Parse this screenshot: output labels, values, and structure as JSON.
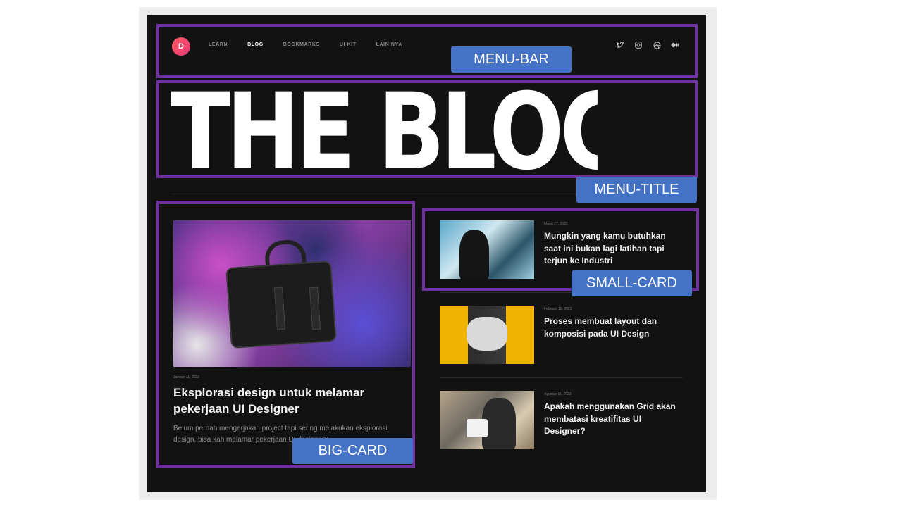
{
  "brand": {
    "avatar_letter": "D",
    "avatar_colors": [
      "#ff5a5f",
      "#e8357a"
    ]
  },
  "nav": {
    "items": [
      "LEARN",
      "BLOG",
      "BOOKMARKS",
      "UI KIT",
      "LAIN NYA"
    ],
    "active": "BLOG"
  },
  "socials": [
    "twitter-icon",
    "instagram-icon",
    "dribbble-icon",
    "medium-icon"
  ],
  "hero": {
    "title": "THE BLOG"
  },
  "big_card": {
    "date": "Januari 11, 2022",
    "title": "Eksplorasi design untuk melamar pekerjaan UI Designer",
    "excerpt": "Belum pernah mengerjakan project tapi sering melakukan eksplorasi design, bisa kah melamar pekerjaan UI designer?"
  },
  "small_cards": [
    {
      "date": "Maret 27, 2022",
      "title": "Mungkin yang kamu butuhkan saat ini bukan lagi latihan tapi terjun ke Industri"
    },
    {
      "date": "Februari 15, 2022",
      "title": "Proses membuat layout dan komposisi pada UI Design"
    },
    {
      "date": "Agustus 11, 2021",
      "title": "Apakah menggunakan Grid akan membatasi kreatifitas UI Designer?"
    }
  ],
  "annotations": {
    "menu_bar": "MENU-BAR",
    "menu_title": "MENU-TITLE",
    "big_card": "BIG-CARD",
    "small_card": "SMALL-CARD",
    "box_color": "#7030a0",
    "tag_color": "#4472c4"
  }
}
